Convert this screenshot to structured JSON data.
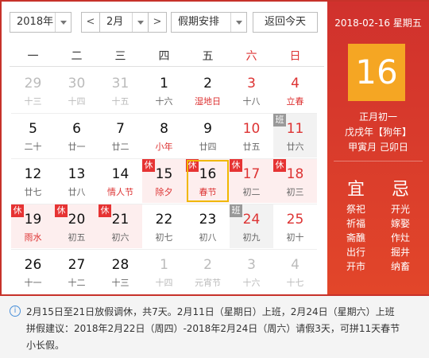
{
  "toolbar": {
    "year_value": "2018年",
    "prev_symbol": "<",
    "month_value": "2月",
    "next_symbol": ">",
    "holiday_value": "假期安排",
    "today_label": "返回今天"
  },
  "weekdays": [
    "一",
    "二",
    "三",
    "四",
    "五",
    "六",
    "日"
  ],
  "weeks": [
    [
      {
        "day": "29",
        "sub": "十三",
        "other": true
      },
      {
        "day": "30",
        "sub": "十四",
        "other": true
      },
      {
        "day": "31",
        "sub": "十五",
        "other": true
      },
      {
        "day": "1",
        "sub": "十六"
      },
      {
        "day": "2",
        "sub": "湿地日",
        "festival": true
      },
      {
        "day": "3",
        "sub": "十八"
      },
      {
        "day": "4",
        "sub": "立春",
        "festival": true
      }
    ],
    [
      {
        "day": "5",
        "sub": "二十"
      },
      {
        "day": "6",
        "sub": "廿一"
      },
      {
        "day": "7",
        "sub": "廿二"
      },
      {
        "day": "8",
        "sub": "小年",
        "festival": true
      },
      {
        "day": "9",
        "sub": "廿四"
      },
      {
        "day": "10",
        "sub": "廿五"
      },
      {
        "day": "11",
        "sub": "廿六",
        "badge": "班",
        "type": "workday"
      }
    ],
    [
      {
        "day": "12",
        "sub": "廿七"
      },
      {
        "day": "13",
        "sub": "廿八"
      },
      {
        "day": "14",
        "sub": "情人节",
        "festival": true
      },
      {
        "day": "15",
        "sub": "除夕",
        "festival": true,
        "badge": "休",
        "type": "holiday"
      },
      {
        "day": "16",
        "sub": "春节",
        "festival": true,
        "badge": "休",
        "type": "holiday",
        "today": true
      },
      {
        "day": "17",
        "sub": "初二",
        "badge": "休",
        "type": "holiday"
      },
      {
        "day": "18",
        "sub": "初三",
        "badge": "休",
        "type": "holiday"
      }
    ],
    [
      {
        "day": "19",
        "sub": "雨水",
        "festival": true,
        "badge": "休",
        "type": "holiday"
      },
      {
        "day": "20",
        "sub": "初五",
        "badge": "休",
        "type": "holiday"
      },
      {
        "day": "21",
        "sub": "初六",
        "badge": "休",
        "type": "holiday"
      },
      {
        "day": "22",
        "sub": "初七"
      },
      {
        "day": "23",
        "sub": "初八"
      },
      {
        "day": "24",
        "sub": "初九",
        "badge": "班",
        "type": "workday"
      },
      {
        "day": "25",
        "sub": "初十"
      }
    ],
    [
      {
        "day": "26",
        "sub": "十一"
      },
      {
        "day": "27",
        "sub": "十二"
      },
      {
        "day": "28",
        "sub": "十三"
      },
      {
        "day": "1",
        "sub": "十四",
        "other": true
      },
      {
        "day": "2",
        "sub": "元宵节",
        "other": true
      },
      {
        "day": "3",
        "sub": "十六",
        "other": true
      },
      {
        "day": "4",
        "sub": "十七",
        "other": true
      }
    ]
  ],
  "panel": {
    "date_line": "2018-02-16 星期五",
    "big_day": "16",
    "lunar_date": "正月初一",
    "ganzhi_year": "戊戌年【狗年】",
    "ganzhi_month_day": "甲寅月 己卯日",
    "yi_label": "宜",
    "ji_label": "忌",
    "yi_items": [
      "祭祀",
      "祈福",
      "斋醮",
      "出行",
      "开市"
    ],
    "ji_items": [
      "开光",
      "嫁娶",
      "作灶",
      "掘井",
      "纳畜"
    ]
  },
  "info": {
    "icon": "info-icon",
    "line1": "2月15日至21日放假调休，共7天。2月11日（星期日）上班，2月24日（星期六）上班",
    "line2": "拼假建议：2018年2月22日（周四）-2018年2月24日（周六）请假3天，可拼11天春节",
    "line3": "小长假。"
  }
}
